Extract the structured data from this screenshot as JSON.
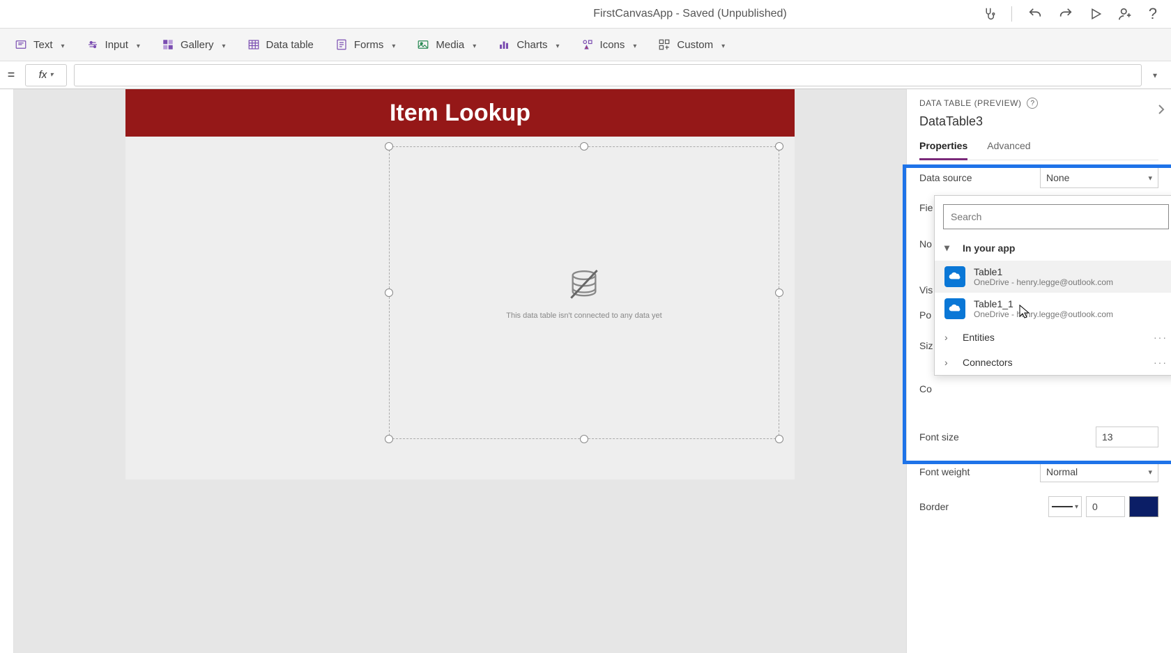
{
  "title": "FirstCanvasApp - Saved (Unpublished)",
  "ribbon": {
    "text": "Text",
    "input": "Input",
    "gallery": "Gallery",
    "datatable": "Data table",
    "forms": "Forms",
    "media": "Media",
    "charts": "Charts",
    "icons": "Icons",
    "custom": "Custom"
  },
  "canvas": {
    "header": "Item Lookup",
    "dt_empty_msg": "This data table isn't connected to any data yet"
  },
  "panel": {
    "type_label": "DATA TABLE (PREVIEW)",
    "control_name": "DataTable3",
    "tab_properties": "Properties",
    "tab_advanced": "Advanced",
    "row_datasource": "Data source",
    "row_datasource_val": "None",
    "row_fields_trunc": "Fie",
    "row_no_trunc": "No",
    "row_vis_trunc": "Vis",
    "row_po_trunc": "Po",
    "row_siz_trunc": "Siz",
    "row_co_trunc": "Co",
    "row_fontsize": "Font size",
    "row_fontsize_val": "13",
    "row_fontweight": "Font weight",
    "row_fontweight_val": "Normal",
    "row_border": "Border",
    "row_border_val": "0"
  },
  "flyout": {
    "search_placeholder": "Search",
    "section_inapp": "In your app",
    "section_entities": "Entities",
    "section_connectors": "Connectors",
    "items": [
      {
        "name": "Table1",
        "sub": "OneDrive - henry.legge@outlook.com"
      },
      {
        "name": "Table1_1",
        "sub": "OneDrive - henry.legge@outlook.com"
      }
    ]
  }
}
